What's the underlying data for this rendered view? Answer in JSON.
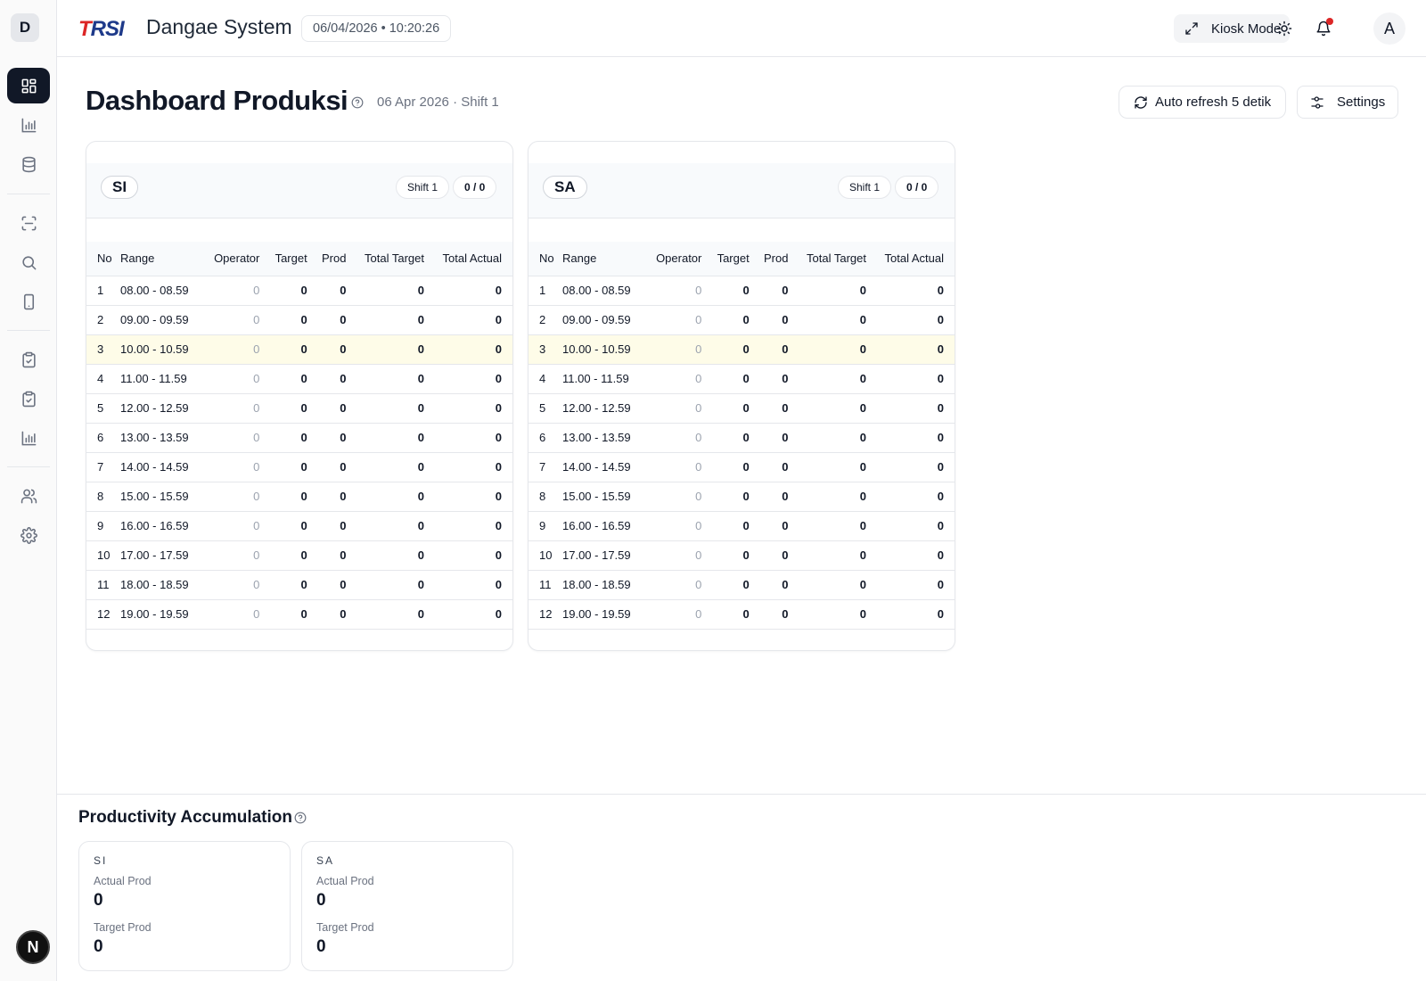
{
  "sidebar": {
    "brand_initial": "D",
    "items": [
      {
        "icon": "layout-grid-icon",
        "active": true
      },
      {
        "icon": "bar-chart-icon"
      },
      {
        "icon": "database-icon"
      },
      {
        "icon": "scan-icon"
      },
      {
        "icon": "search-icon"
      },
      {
        "icon": "tablet-icon"
      },
      {
        "icon": "clipboard-check-icon"
      },
      {
        "icon": "clipboard-check-icon"
      },
      {
        "icon": "bar-chart-icon"
      },
      {
        "icon": "users-icon"
      },
      {
        "icon": "gear-icon"
      }
    ],
    "footer_badge": "N"
  },
  "header": {
    "logo": "TRSI",
    "app_title": "Dangae System",
    "datetime": "06/04/2026 • 10:20:26",
    "kiosk_label": "Kiosk Mode",
    "avatar_initial": "A",
    "notification_dot_color": "#dc2626"
  },
  "page": {
    "title": "Dashboard Produksi",
    "subtitle": "06 Apr 2026 · Shift 1",
    "refresh_label": "Auto refresh 5 detik",
    "settings_label": "Settings"
  },
  "columns": [
    "No",
    "Range",
    "Operator",
    "Target",
    "Prod",
    "Total Target",
    "Total Actual"
  ],
  "highlight_row_color": "#fefce8",
  "lines": [
    {
      "name": "SI",
      "shift": "Shift 1",
      "count": "0 / 0",
      "rows": [
        {
          "no": "1",
          "range": "08.00 - 08.59",
          "operator": "0",
          "target": "0",
          "prod": "0",
          "total_target": "0",
          "total_actual": "0"
        },
        {
          "no": "2",
          "range": "09.00 - 09.59",
          "operator": "0",
          "target": "0",
          "prod": "0",
          "total_target": "0",
          "total_actual": "0"
        },
        {
          "no": "3",
          "range": "10.00 - 10.59",
          "operator": "0",
          "target": "0",
          "prod": "0",
          "total_target": "0",
          "total_actual": "0",
          "highlight": true
        },
        {
          "no": "4",
          "range": "11.00 - 11.59",
          "operator": "0",
          "target": "0",
          "prod": "0",
          "total_target": "0",
          "total_actual": "0"
        },
        {
          "no": "5",
          "range": "12.00 - 12.59",
          "operator": "0",
          "target": "0",
          "prod": "0",
          "total_target": "0",
          "total_actual": "0"
        },
        {
          "no": "6",
          "range": "13.00 - 13.59",
          "operator": "0",
          "target": "0",
          "prod": "0",
          "total_target": "0",
          "total_actual": "0"
        },
        {
          "no": "7",
          "range": "14.00 - 14.59",
          "operator": "0",
          "target": "0",
          "prod": "0",
          "total_target": "0",
          "total_actual": "0"
        },
        {
          "no": "8",
          "range": "15.00 - 15.59",
          "operator": "0",
          "target": "0",
          "prod": "0",
          "total_target": "0",
          "total_actual": "0"
        },
        {
          "no": "9",
          "range": "16.00 - 16.59",
          "operator": "0",
          "target": "0",
          "prod": "0",
          "total_target": "0",
          "total_actual": "0"
        },
        {
          "no": "10",
          "range": "17.00 - 17.59",
          "operator": "0",
          "target": "0",
          "prod": "0",
          "total_target": "0",
          "total_actual": "0"
        },
        {
          "no": "11",
          "range": "18.00 - 18.59",
          "operator": "0",
          "target": "0",
          "prod": "0",
          "total_target": "0",
          "total_actual": "0"
        },
        {
          "no": "12",
          "range": "19.00 - 19.59",
          "operator": "0",
          "target": "0",
          "prod": "0",
          "total_target": "0",
          "total_actual": "0"
        }
      ]
    },
    {
      "name": "SA",
      "shift": "Shift 1",
      "count": "0 / 0",
      "rows": [
        {
          "no": "1",
          "range": "08.00 - 08.59",
          "operator": "0",
          "target": "0",
          "prod": "0",
          "total_target": "0",
          "total_actual": "0"
        },
        {
          "no": "2",
          "range": "09.00 - 09.59",
          "operator": "0",
          "target": "0",
          "prod": "0",
          "total_target": "0",
          "total_actual": "0"
        },
        {
          "no": "3",
          "range": "10.00 - 10.59",
          "operator": "0",
          "target": "0",
          "prod": "0",
          "total_target": "0",
          "total_actual": "0",
          "highlight": true
        },
        {
          "no": "4",
          "range": "11.00 - 11.59",
          "operator": "0",
          "target": "0",
          "prod": "0",
          "total_target": "0",
          "total_actual": "0"
        },
        {
          "no": "5",
          "range": "12.00 - 12.59",
          "operator": "0",
          "target": "0",
          "prod": "0",
          "total_target": "0",
          "total_actual": "0"
        },
        {
          "no": "6",
          "range": "13.00 - 13.59",
          "operator": "0",
          "target": "0",
          "prod": "0",
          "total_target": "0",
          "total_actual": "0"
        },
        {
          "no": "7",
          "range": "14.00 - 14.59",
          "operator": "0",
          "target": "0",
          "prod": "0",
          "total_target": "0",
          "total_actual": "0"
        },
        {
          "no": "8",
          "range": "15.00 - 15.59",
          "operator": "0",
          "target": "0",
          "prod": "0",
          "total_target": "0",
          "total_actual": "0"
        },
        {
          "no": "9",
          "range": "16.00 - 16.59",
          "operator": "0",
          "target": "0",
          "prod": "0",
          "total_target": "0",
          "total_actual": "0"
        },
        {
          "no": "10",
          "range": "17.00 - 17.59",
          "operator": "0",
          "target": "0",
          "prod": "0",
          "total_target": "0",
          "total_actual": "0"
        },
        {
          "no": "11",
          "range": "18.00 - 18.59",
          "operator": "0",
          "target": "0",
          "prod": "0",
          "total_target": "0",
          "total_actual": "0"
        },
        {
          "no": "12",
          "range": "19.00 - 19.59",
          "operator": "0",
          "target": "0",
          "prod": "0",
          "total_target": "0",
          "total_actual": "0"
        }
      ]
    }
  ],
  "productivity": {
    "title": "Productivity Accumulation",
    "cards": [
      {
        "name": "SI",
        "actual_label": "Actual Prod",
        "actual_value": "0",
        "target_label": "Target Prod",
        "target_value": "0"
      },
      {
        "name": "SA",
        "actual_label": "Actual Prod",
        "actual_value": "0",
        "target_label": "Target Prod",
        "target_value": "0"
      }
    ]
  }
}
